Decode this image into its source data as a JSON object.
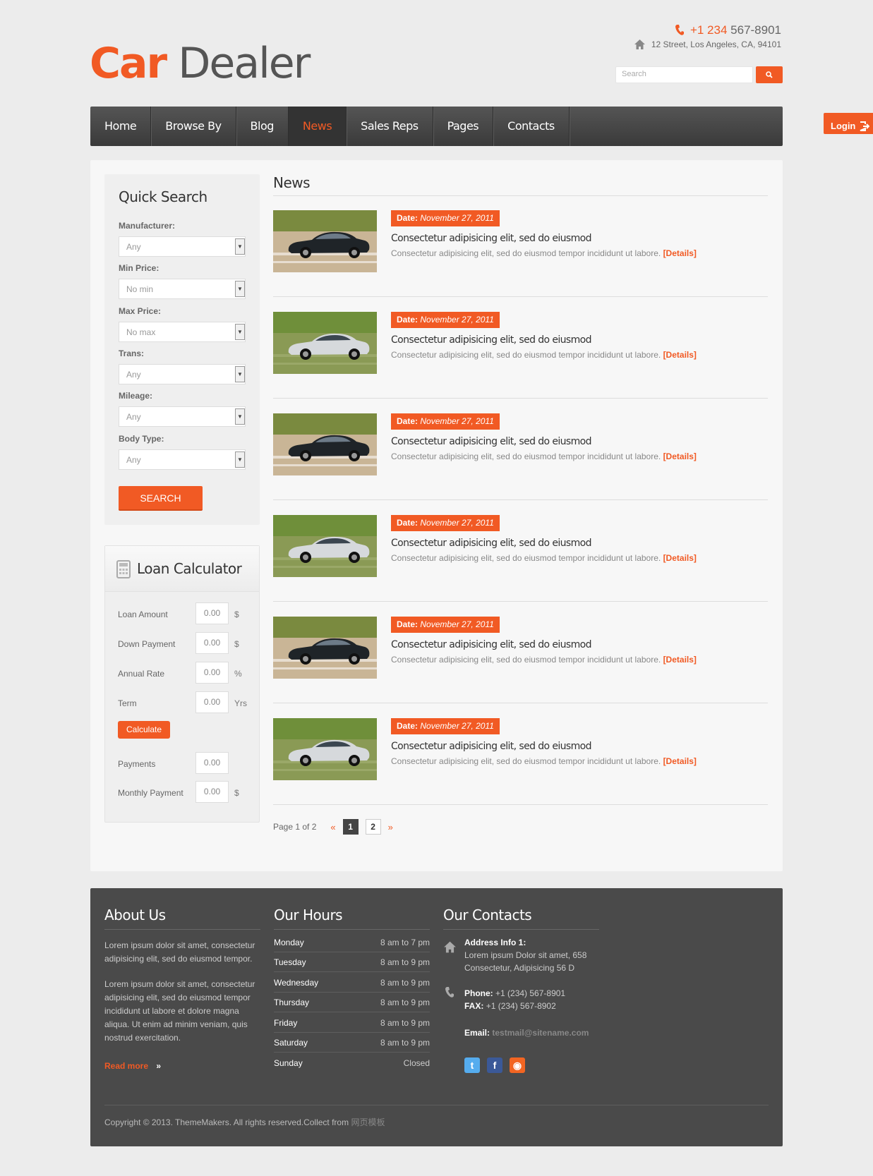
{
  "brand": {
    "logo_part1": "Car",
    "logo_part2": "Dealer"
  },
  "header": {
    "phone_prefix": "+1 234",
    "phone_rest": "567-8901",
    "address": "12 Street, Los Angeles, CA, 94101",
    "search_placeholder": "Search"
  },
  "nav": [
    "Home",
    "Browse By",
    "Blog",
    "News",
    "Sales Reps",
    "Pages",
    "Contacts"
  ],
  "nav_active": "News",
  "login_label": "Login",
  "quick_search": {
    "title": "Quick Search",
    "fields": [
      {
        "label": "Manufacturer:",
        "value": "Any"
      },
      {
        "label": "Min Price:",
        "value": "No min"
      },
      {
        "label": "Max Price:",
        "value": "No max"
      },
      {
        "label": "Trans:",
        "value": "Any"
      },
      {
        "label": "Mileage:",
        "value": "Any"
      },
      {
        "label": "Body Type:",
        "value": "Any"
      }
    ],
    "button": "SEARCH"
  },
  "loan": {
    "title": "Loan Calculator",
    "rows": [
      {
        "label": "Loan Amount",
        "value": "0.00",
        "unit": "$"
      },
      {
        "label": "Down Payment",
        "value": "0.00",
        "unit": "$"
      },
      {
        "label": "Annual Rate",
        "value": "0.00",
        "unit": "%"
      },
      {
        "label": "Term",
        "value": "0.00",
        "unit": "Yrs"
      }
    ],
    "button": "Calculate",
    "results": [
      {
        "label": "Payments",
        "value": "0.00",
        "unit": ""
      },
      {
        "label": "Monthly Payment",
        "value": "0.00",
        "unit": "$"
      }
    ]
  },
  "news": {
    "title": "News",
    "items": [
      {
        "date_label": "Date:",
        "date": "November 27, 2011",
        "heading": "Consectetur adipisicing elit, sed do eiusmod",
        "text": "Consectetur adipisicing elit, sed do eiusmod tempor incididunt ut labore.",
        "details": "[Details]",
        "car": "dark"
      },
      {
        "date_label": "Date:",
        "date": "November 27, 2011",
        "heading": "Consectetur adipisicing elit, sed do eiusmod",
        "text": "Consectetur adipisicing elit, sed do eiusmod tempor incididunt ut labore.",
        "details": "[Details]",
        "car": "silver"
      },
      {
        "date_label": "Date:",
        "date": "November 27, 2011",
        "heading": "Consectetur adipisicing elit, sed do eiusmod",
        "text": "Consectetur adipisicing elit, sed do eiusmod tempor incididunt ut labore.",
        "details": "[Details]",
        "car": "dark"
      },
      {
        "date_label": "Date:",
        "date": "November 27, 2011",
        "heading": "Consectetur adipisicing elit, sed do eiusmod",
        "text": "Consectetur adipisicing elit, sed do eiusmod tempor incididunt ut labore.",
        "details": "[Details]",
        "car": "silver"
      },
      {
        "date_label": "Date:",
        "date": "November 27, 2011",
        "heading": "Consectetur adipisicing elit, sed do eiusmod",
        "text": "Consectetur adipisicing elit, sed do eiusmod tempor incididunt ut labore.",
        "details": "[Details]",
        "car": "dark"
      },
      {
        "date_label": "Date:",
        "date": "November 27, 2011",
        "heading": "Consectetur adipisicing elit, sed do eiusmod",
        "text": "Consectetur adipisicing elit, sed do eiusmod tempor incididunt ut labore.",
        "details": "[Details]",
        "car": "silver"
      }
    ]
  },
  "pager": {
    "label": "Page 1 of 2",
    "prev": "«",
    "pages": [
      "1",
      "2"
    ],
    "current": "1",
    "next": "»"
  },
  "footer": {
    "about": {
      "title": "About Us",
      "p1": "Lorem ipsum dolor sit amet, consectetur adipisicing elit, sed do eiusmod tempor.",
      "p2": "Lorem ipsum dolor sit amet, consectetur adipisicing elit, sed do eiusmod tempor incididunt ut labore et dolore magna aliqua. Ut enim ad minim veniam, quis nostrud exercitation.",
      "read_more": "Read more"
    },
    "hours": {
      "title": "Our Hours",
      "rows": [
        {
          "day": "Monday",
          "time": "8 am to 7 pm"
        },
        {
          "day": "Tuesday",
          "time": "8 am to 9 pm"
        },
        {
          "day": "Wednesday",
          "time": "8 am to 9 pm"
        },
        {
          "day": "Thursday",
          "time": "8 am to 9 pm"
        },
        {
          "day": "Friday",
          "time": "8 am to 9 pm"
        },
        {
          "day": "Saturday",
          "time": "8 am to 9 pm"
        },
        {
          "day": "Sunday",
          "time": "Closed"
        }
      ]
    },
    "contacts": {
      "title": "Our Contacts",
      "address_label": "Address Info 1:",
      "address_l1": "Lorem ipsum Dolor sit amet, 658",
      "address_l2": "Consectetur, Adipisicing 56 D",
      "phone_label": "Phone:",
      "phone": "+1 (234) 567-8901",
      "fax_label": "FAX:",
      "fax": "+1 (234) 567-8902",
      "email_label": "Email:",
      "email": "testmail@sitename.com"
    },
    "copyright": "Copyright © 2013. ThemeMakers. All rights reserved.Collect from",
    "copyright_link": "网页模板"
  },
  "colors": {
    "accent": "#f15a24",
    "nav_bg": "#444444",
    "footer_bg": "#4a4a4a"
  },
  "icons": [
    "phone-icon",
    "home-icon",
    "search-icon",
    "login-icon",
    "calculator-icon",
    "twitter-icon",
    "facebook-icon",
    "rss-icon"
  ]
}
